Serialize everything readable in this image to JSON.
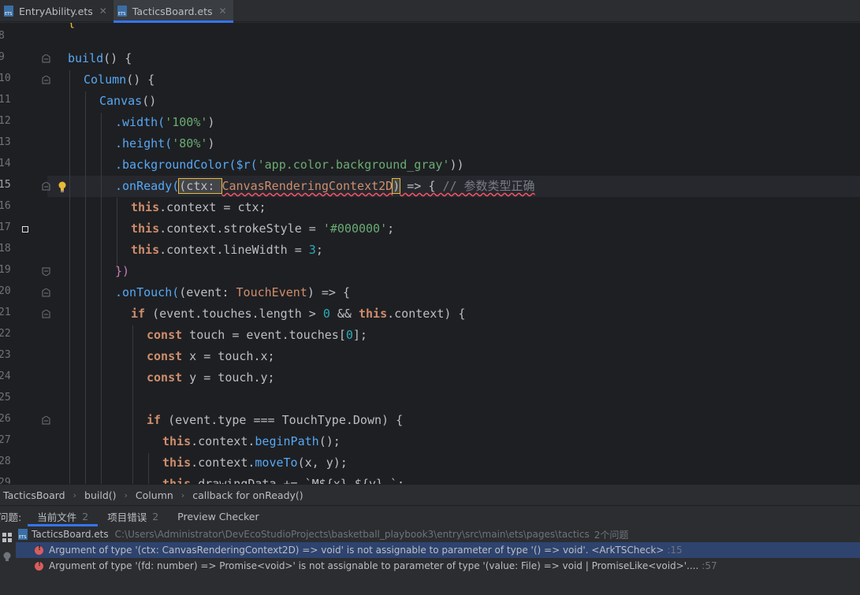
{
  "tabs": [
    {
      "label": "EntryAbility.ets",
      "active": false
    },
    {
      "label": "TacticsBoard.ets",
      "active": true
    }
  ],
  "line_numbers": [
    "8",
    "9",
    "10",
    "11",
    "12",
    "13",
    "14",
    "15",
    "16",
    "17",
    "18",
    "19",
    "20",
    "21",
    "22",
    "23",
    "24",
    "25",
    "26",
    "27",
    "28",
    "29"
  ],
  "code": {
    "l9": {
      "a": "build",
      "b": "() {"
    },
    "l10": {
      "a": "Column",
      "b": "() {"
    },
    "l11": {
      "a": "Canvas",
      "b": "()"
    },
    "l12": {
      "a": ".width(",
      "b": "'100%'",
      "c": ")"
    },
    "l13": {
      "a": ".height(",
      "b": "'80%'",
      "c": ")"
    },
    "l14": {
      "a": ".backgroundColor($r(",
      "b": "'app.color.background_gray'",
      "c": "))"
    },
    "l15": {
      "a": ".onReady(",
      "b": "(ctx: ",
      "c": "CanvasRenderingContext2D",
      "d": ")",
      "e": " => { ",
      "f": "// 参数类型正确"
    },
    "l16": {
      "a": "this",
      "b": ".context = ctx;"
    },
    "l17": {
      "a": "this",
      "b": ".context.strokeStyle = ",
      "c": "'#000000'",
      "d": ";"
    },
    "l18": {
      "a": "this",
      "b": ".context.lineWidth = ",
      "c": "3",
      "d": ";"
    },
    "l19": {
      "a": "})"
    },
    "l20": {
      "a": ".onTouch(",
      "b": "(event: ",
      "c": "TouchEvent",
      "d": ") => {"
    },
    "l21": {
      "a": "if",
      "b": " (event.touches.length > ",
      "c": "0",
      "d": " && ",
      "e": "this",
      "f": ".context) {"
    },
    "l22": {
      "a": "const",
      "b": " touch = event.touches[",
      "c": "0",
      "d": "];"
    },
    "l23": {
      "a": "const",
      "b": " x = touch.x;"
    },
    "l24": {
      "a": "const",
      "b": " y = touch.y;"
    },
    "l26": {
      "a": "if",
      "b": " (event.type === TouchType.Down) {"
    },
    "l27": {
      "a": "this",
      "b": ".context.",
      "c": "beginPath",
      "d": "();"
    },
    "l28": {
      "a": "this",
      "b": ".context.",
      "c": "moveTo",
      "d": "(x, y);"
    },
    "l29": {
      "a": "this",
      "b": ".drawingData += `M${x},${y} `;"
    }
  },
  "breadcrumb": [
    "TacticsBoard",
    "build()",
    "Column",
    "callback for onReady()"
  ],
  "problems": {
    "label": "问题:",
    "tabs": [
      {
        "label": "当前文件",
        "count": "2",
        "active": true
      },
      {
        "label": "项目错误",
        "count": "2",
        "active": false
      },
      {
        "label": "Preview Checker",
        "count": "",
        "active": false
      }
    ],
    "file": {
      "name": "TacticsBoard.ets",
      "path": "C:\\Users\\Administrator\\DevEcoStudioProjects\\basketball_playbook3\\entry\\src\\main\\ets\\pages\\tactics",
      "count_text": "2个问题"
    },
    "items": [
      {
        "message": "Argument of type '(ctx: CanvasRenderingContext2D) => void' is not assignable to parameter of type '() => void'. <ArkTSCheck>",
        "loc": ":15"
      },
      {
        "message": "Argument of type '(fd: number) => Promise<void>' is not assignable to parameter of type '(value: File) => void | PromiseLike<void>'....",
        "loc": ":57"
      }
    ]
  },
  "colors": {
    "accent": "#3574f0",
    "error": "#db5c5c",
    "selection": "#2e436e"
  }
}
